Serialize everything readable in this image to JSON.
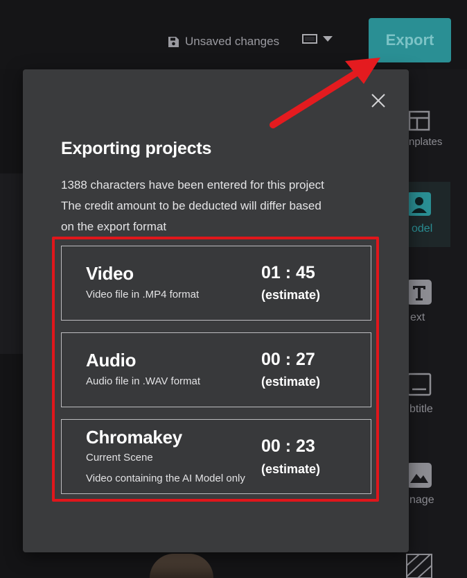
{
  "header": {
    "unsaved_label": "Unsaved changes",
    "export_label": "Export"
  },
  "right_panel": {
    "items": [
      {
        "label": "nplates",
        "icon": "templates-icon"
      },
      {
        "label": "odel",
        "icon": "model-icon"
      },
      {
        "label": "ext",
        "icon": "text-icon"
      },
      {
        "label": "btitle",
        "icon": "subtitle-icon"
      },
      {
        "label": "nage",
        "icon": "image-icon"
      }
    ]
  },
  "modal": {
    "title": "Exporting projects",
    "desc_line1": "1388 characters have been entered for this project",
    "desc_line2": "The credit amount to be deducted will differ based",
    "desc_line3": "on the export format",
    "options": [
      {
        "name": "Video",
        "sub": "Video file in .MP4 format",
        "time": "01 : 45",
        "estimate": "(estimate)"
      },
      {
        "name": "Audio",
        "sub": "Audio file in .WAV format",
        "time": "00 : 27",
        "estimate": "(estimate)"
      },
      {
        "name": "Chromakey",
        "sub": "Current Scene",
        "sub2": "Video containing the AI Model only",
        "time": "00 : 23",
        "estimate": "(estimate)"
      }
    ]
  },
  "colors": {
    "export_button": "#2a8f94",
    "highlight": "#e0161b",
    "modal_bg": "#3a3b3d",
    "page_bg": "#141416"
  }
}
